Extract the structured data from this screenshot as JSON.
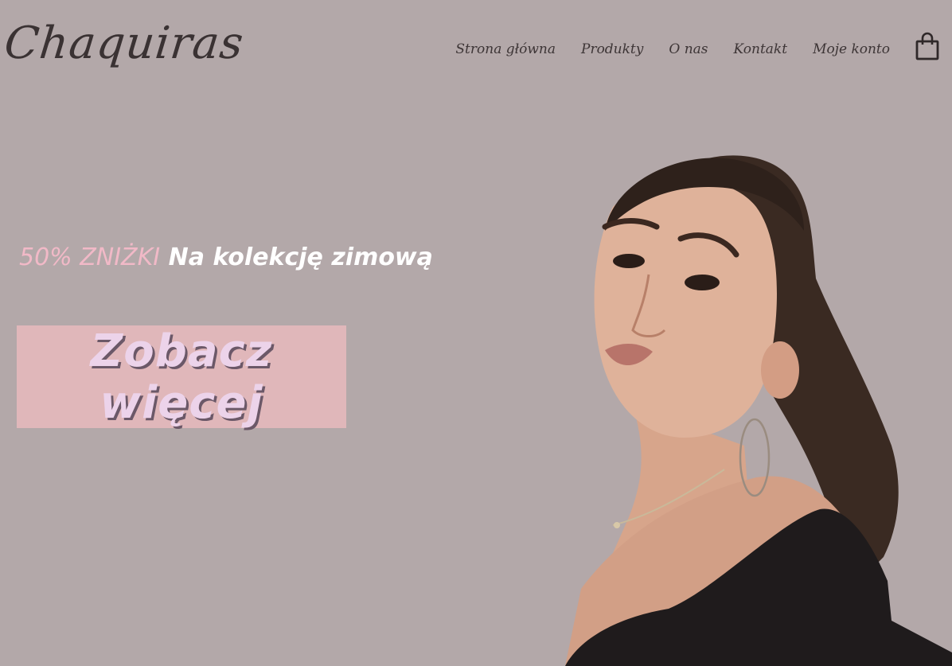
{
  "brand": {
    "logo_text": "Chaquiras"
  },
  "nav": {
    "items": [
      {
        "label": "Strona główna"
      },
      {
        "label": "Produkty"
      },
      {
        "label": "O nas"
      },
      {
        "label": "Kontakt"
      },
      {
        "label": "Moje konto"
      }
    ],
    "cart_icon": "shopping-bag-icon"
  },
  "hero": {
    "promo_accent": "50% ZNIŻKI",
    "promo_text": "Na kolekcję zimową",
    "cta_label": "Zobacz więcej",
    "photo": "woman-portrait-image"
  },
  "colors": {
    "background": "#b3a8a9",
    "cta_background": "#e0b7ba",
    "promo_accent": "#f1b9c7",
    "logo": "#3a3233"
  }
}
